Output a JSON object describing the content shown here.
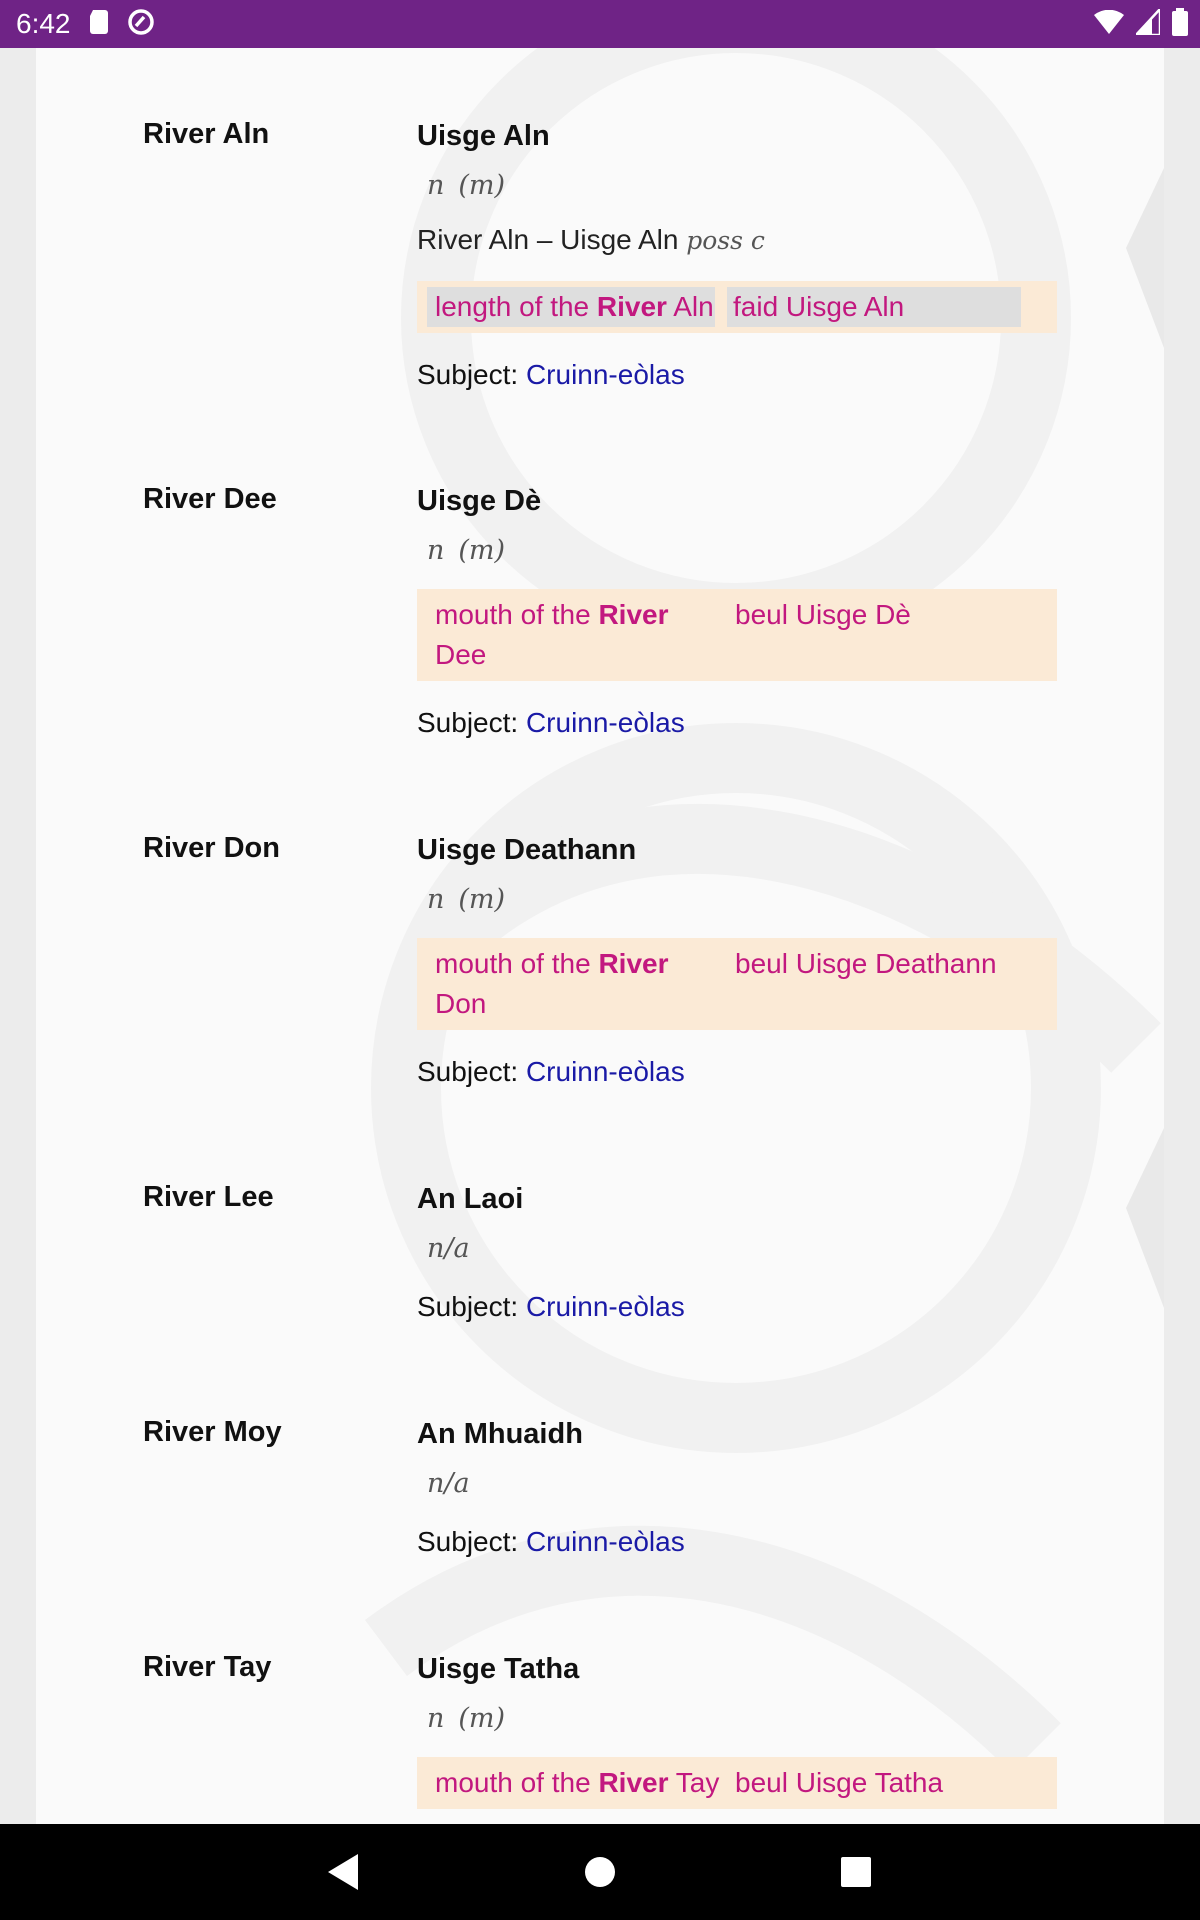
{
  "status_bar": {
    "time": "6:42",
    "left_icons": [
      "sd-card-icon",
      "sync-icon"
    ],
    "right_icons": [
      "wifi-icon",
      "signal-icon",
      "battery-icon"
    ],
    "color": "#6f2386"
  },
  "entries": [
    {
      "headword": "River Aln",
      "translation": "Uisge Aln",
      "gram": [
        "n",
        "(m)"
      ],
      "possessive": {
        "text": "River Aln – Uisge Aln",
        "tag": "poss c"
      },
      "example": {
        "en_pre": "length of the ",
        "en_bold": "River",
        "en_post": " Aln",
        "gd": "faid Uisge Aln",
        "highlighted": true
      },
      "subject_label": "Subject:",
      "subject_link": "Cruinn-eòlas"
    },
    {
      "headword": "River Dee",
      "translation": "Uisge Dè",
      "gram": [
        "n",
        "(m)"
      ],
      "example": {
        "en_pre": "mouth of the ",
        "en_bold": "River",
        "en_post": " Dee",
        "gd": "beul Uisge Dè",
        "highlighted": false
      },
      "subject_label": "Subject:",
      "subject_link": "Cruinn-eòlas"
    },
    {
      "headword": "River Don",
      "translation": "Uisge Deathann",
      "gram": [
        "n",
        "(m)"
      ],
      "example": {
        "en_pre": "mouth of the ",
        "en_bold": "River",
        "en_post": " Don",
        "gd": "beul Uisge Deathann",
        "highlighted": false
      },
      "subject_label": "Subject:",
      "subject_link": "Cruinn-eòlas"
    },
    {
      "headword": "River Lee",
      "translation": "An Laoi",
      "gram": [
        "n/a"
      ],
      "subject_label": "Subject:",
      "subject_link": "Cruinn-eòlas"
    },
    {
      "headword": "River Moy",
      "translation": "An Mhuaidh",
      "gram": [
        "n/a"
      ],
      "subject_label": "Subject:",
      "subject_link": "Cruinn-eòlas"
    },
    {
      "headword": "River Tay",
      "translation": "Uisge Tatha",
      "gram": [
        "n",
        "(m)"
      ],
      "example": {
        "en_pre": "mouth of the ",
        "en_bold": "River",
        "en_post": " Tay",
        "gd": "beul Uisge Tatha",
        "highlighted": false
      }
    }
  ],
  "nav_bar": {
    "buttons": [
      "back-icon",
      "home-icon",
      "recents-icon"
    ]
  }
}
